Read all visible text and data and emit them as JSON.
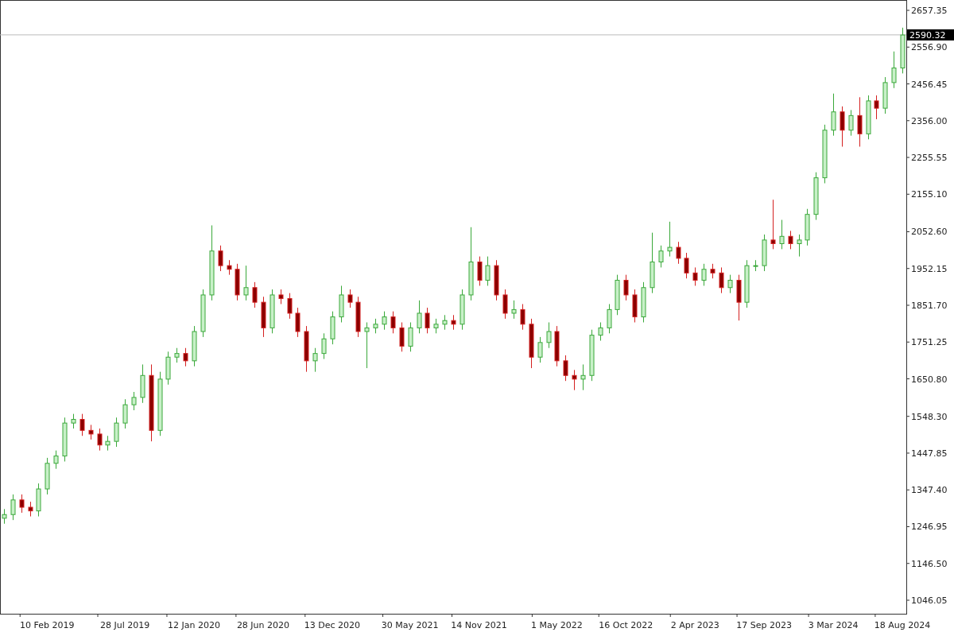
{
  "chart_data": {
    "type": "candlestick",
    "ylim": [
      1009.1,
      2685.6
    ],
    "categories": [
      null,
      null,
      null,
      null,
      null,
      "10 Feb 2019",
      null,
      null,
      null,
      null,
      null,
      null,
      null,
      null,
      "28 Jul 2019",
      null,
      null,
      null,
      null,
      null,
      null,
      null,
      "12 Jan 2020",
      null,
      null,
      null,
      null,
      null,
      null,
      null,
      "28 Jun 2020",
      null,
      null,
      null,
      null,
      null,
      null,
      null,
      "13 Dec 2020",
      null,
      null,
      null,
      null,
      null,
      null,
      null,
      null,
      "30 May 2021",
      null,
      null,
      null,
      null,
      null,
      null,
      null,
      "14 Nov 2021",
      null,
      null,
      null,
      null,
      null,
      null,
      null,
      null,
      "1 May 2022",
      null,
      null,
      null,
      null,
      null,
      null,
      null,
      "16 Oct 2022",
      null,
      null,
      null,
      null,
      null,
      null,
      null,
      "2 Apr 2023",
      null,
      null,
      null,
      null,
      null,
      null,
      null,
      "17 Sep 2023",
      null,
      null,
      null,
      null,
      null,
      null,
      null,
      "3 Mar 2024",
      null,
      null,
      null,
      null,
      null,
      null,
      null,
      "18 Aug 2024"
    ],
    "ohlc": [
      [
        1270,
        1295,
        1255,
        1280
      ],
      [
        1280,
        1335,
        1265,
        1320
      ],
      [
        1320,
        1335,
        1285,
        1300
      ],
      [
        1300,
        1315,
        1275,
        1290
      ],
      [
        1290,
        1365,
        1275,
        1350
      ],
      [
        1350,
        1435,
        1335,
        1420
      ],
      [
        1420,
        1455,
        1405,
        1440
      ],
      [
        1440,
        1545,
        1425,
        1530
      ],
      [
        1530,
        1555,
        1515,
        1540
      ],
      [
        1540,
        1555,
        1495,
        1510
      ],
      [
        1510,
        1525,
        1485,
        1500
      ],
      [
        1500,
        1515,
        1455,
        1470
      ],
      [
        1470,
        1495,
        1455,
        1480
      ],
      [
        1480,
        1545,
        1465,
        1530
      ],
      [
        1530,
        1595,
        1515,
        1580
      ],
      [
        1580,
        1615,
        1565,
        1600
      ],
      [
        1600,
        1690,
        1585,
        1660
      ],
      [
        1660,
        1690,
        1480,
        1510
      ],
      [
        1510,
        1670,
        1495,
        1650
      ],
      [
        1650,
        1725,
        1635,
        1710
      ],
      [
        1710,
        1735,
        1695,
        1720
      ],
      [
        1720,
        1735,
        1685,
        1700
      ],
      [
        1700,
        1795,
        1685,
        1780
      ],
      [
        1780,
        1895,
        1765,
        1880
      ],
      [
        1880,
        2070,
        1865,
        2000
      ],
      [
        2000,
        2015,
        1945,
        1960
      ],
      [
        1960,
        1975,
        1935,
        1950
      ],
      [
        1950,
        1965,
        1865,
        1880
      ],
      [
        1880,
        1960,
        1865,
        1900
      ],
      [
        1900,
        1915,
        1845,
        1860
      ],
      [
        1860,
        1875,
        1765,
        1790
      ],
      [
        1790,
        1895,
        1775,
        1880
      ],
      [
        1880,
        1895,
        1855,
        1870
      ],
      [
        1870,
        1885,
        1815,
        1830
      ],
      [
        1830,
        1845,
        1765,
        1780
      ],
      [
        1780,
        1795,
        1670,
        1700
      ],
      [
        1700,
        1735,
        1670,
        1720
      ],
      [
        1720,
        1775,
        1705,
        1760
      ],
      [
        1760,
        1835,
        1745,
        1820
      ],
      [
        1820,
        1905,
        1805,
        1880
      ],
      [
        1880,
        1895,
        1845,
        1860
      ],
      [
        1860,
        1875,
        1765,
        1780
      ],
      [
        1780,
        1805,
        1680,
        1790
      ],
      [
        1790,
        1815,
        1775,
        1800
      ],
      [
        1800,
        1835,
        1785,
        1820
      ],
      [
        1820,
        1835,
        1775,
        1790
      ],
      [
        1790,
        1805,
        1725,
        1740
      ],
      [
        1740,
        1805,
        1725,
        1790
      ],
      [
        1790,
        1865,
        1775,
        1830
      ],
      [
        1830,
        1845,
        1775,
        1790
      ],
      [
        1790,
        1815,
        1775,
        1800
      ],
      [
        1800,
        1825,
        1785,
        1810
      ],
      [
        1810,
        1825,
        1785,
        1800
      ],
      [
        1800,
        1895,
        1785,
        1880
      ],
      [
        1880,
        2065,
        1865,
        1970
      ],
      [
        1970,
        1985,
        1905,
        1920
      ],
      [
        1920,
        1985,
        1905,
        1960
      ],
      [
        1960,
        1975,
        1865,
        1880
      ],
      [
        1880,
        1895,
        1815,
        1830
      ],
      [
        1830,
        1865,
        1815,
        1840
      ],
      [
        1840,
        1855,
        1785,
        1800
      ],
      [
        1800,
        1815,
        1680,
        1710
      ],
      [
        1710,
        1765,
        1695,
        1750
      ],
      [
        1750,
        1805,
        1735,
        1780
      ],
      [
        1780,
        1795,
        1685,
        1700
      ],
      [
        1700,
        1715,
        1645,
        1660
      ],
      [
        1660,
        1675,
        1620,
        1650
      ],
      [
        1650,
        1690,
        1620,
        1660
      ],
      [
        1660,
        1785,
        1645,
        1770
      ],
      [
        1770,
        1805,
        1755,
        1790
      ],
      [
        1790,
        1855,
        1775,
        1840
      ],
      [
        1840,
        1935,
        1825,
        1920
      ],
      [
        1920,
        1935,
        1865,
        1880
      ],
      [
        1880,
        1895,
        1805,
        1820
      ],
      [
        1820,
        1915,
        1805,
        1900
      ],
      [
        1900,
        2050,
        1885,
        1970
      ],
      [
        1970,
        2015,
        1955,
        2000
      ],
      [
        2000,
        2080,
        1985,
        2010
      ],
      [
        2010,
        2025,
        1965,
        1980
      ],
      [
        1980,
        1995,
        1925,
        1940
      ],
      [
        1940,
        1955,
        1905,
        1920
      ],
      [
        1920,
        1965,
        1905,
        1950
      ],
      [
        1950,
        1965,
        1925,
        1940
      ],
      [
        1940,
        1955,
        1885,
        1900
      ],
      [
        1900,
        1935,
        1885,
        1920
      ],
      [
        1920,
        1935,
        1810,
        1860
      ],
      [
        1860,
        1975,
        1845,
        1960
      ],
      [
        1960,
        1975,
        1945,
        1960
      ],
      [
        1960,
        2045,
        1945,
        2030
      ],
      [
        2030,
        2140,
        2005,
        2020
      ],
      [
        2020,
        2085,
        2005,
        2040
      ],
      [
        2040,
        2055,
        2005,
        2020
      ],
      [
        2020,
        2045,
        1985,
        2030
      ],
      [
        2030,
        2115,
        2015,
        2100
      ],
      [
        2100,
        2215,
        2085,
        2200
      ],
      [
        2200,
        2345,
        2185,
        2330
      ],
      [
        2330,
        2430,
        2315,
        2380
      ],
      [
        2380,
        2395,
        2285,
        2330
      ],
      [
        2330,
        2385,
        2315,
        2370
      ],
      [
        2370,
        2420,
        2285,
        2320
      ],
      [
        2320,
        2425,
        2305,
        2410
      ],
      [
        2410,
        2425,
        2360,
        2390
      ],
      [
        2390,
        2475,
        2375,
        2460
      ],
      [
        2460,
        2545,
        2445,
        2500
      ],
      [
        2500,
        2610,
        2485,
        2590
      ]
    ],
    "yticks": [
      {
        "value": 2657.35,
        "label": "2657.35"
      },
      {
        "value": 2556.9,
        "label": "2556.90"
      },
      {
        "value": 2456.45,
        "label": "2456.45"
      },
      {
        "value": 2356,
        "label": "2356.00"
      },
      {
        "value": 2255.55,
        "label": "2255.55"
      },
      {
        "value": 2155.1,
        "label": "2155.10"
      },
      {
        "value": 2052.6,
        "label": "2052.60"
      },
      {
        "value": 1952.15,
        "label": "1952.15"
      },
      {
        "value": 1851.7,
        "label": "1851.70"
      },
      {
        "value": 1751.25,
        "label": "1751.25"
      },
      {
        "value": 1650.8,
        "label": "1650.80"
      },
      {
        "value": 1548.3,
        "label": "1548.30"
      },
      {
        "value": 1447.85,
        "label": "1447.85"
      },
      {
        "value": 1347.4,
        "label": "1347.40"
      },
      {
        "value": 1246.95,
        "label": "1246.95"
      },
      {
        "value": 1146.5,
        "label": "1146.50"
      },
      {
        "value": 1046.05,
        "label": "1046.05"
      }
    ],
    "ref_lines": [
      {
        "axis": "y",
        "value": 2590.32,
        "label": "2590.32"
      }
    ]
  }
}
